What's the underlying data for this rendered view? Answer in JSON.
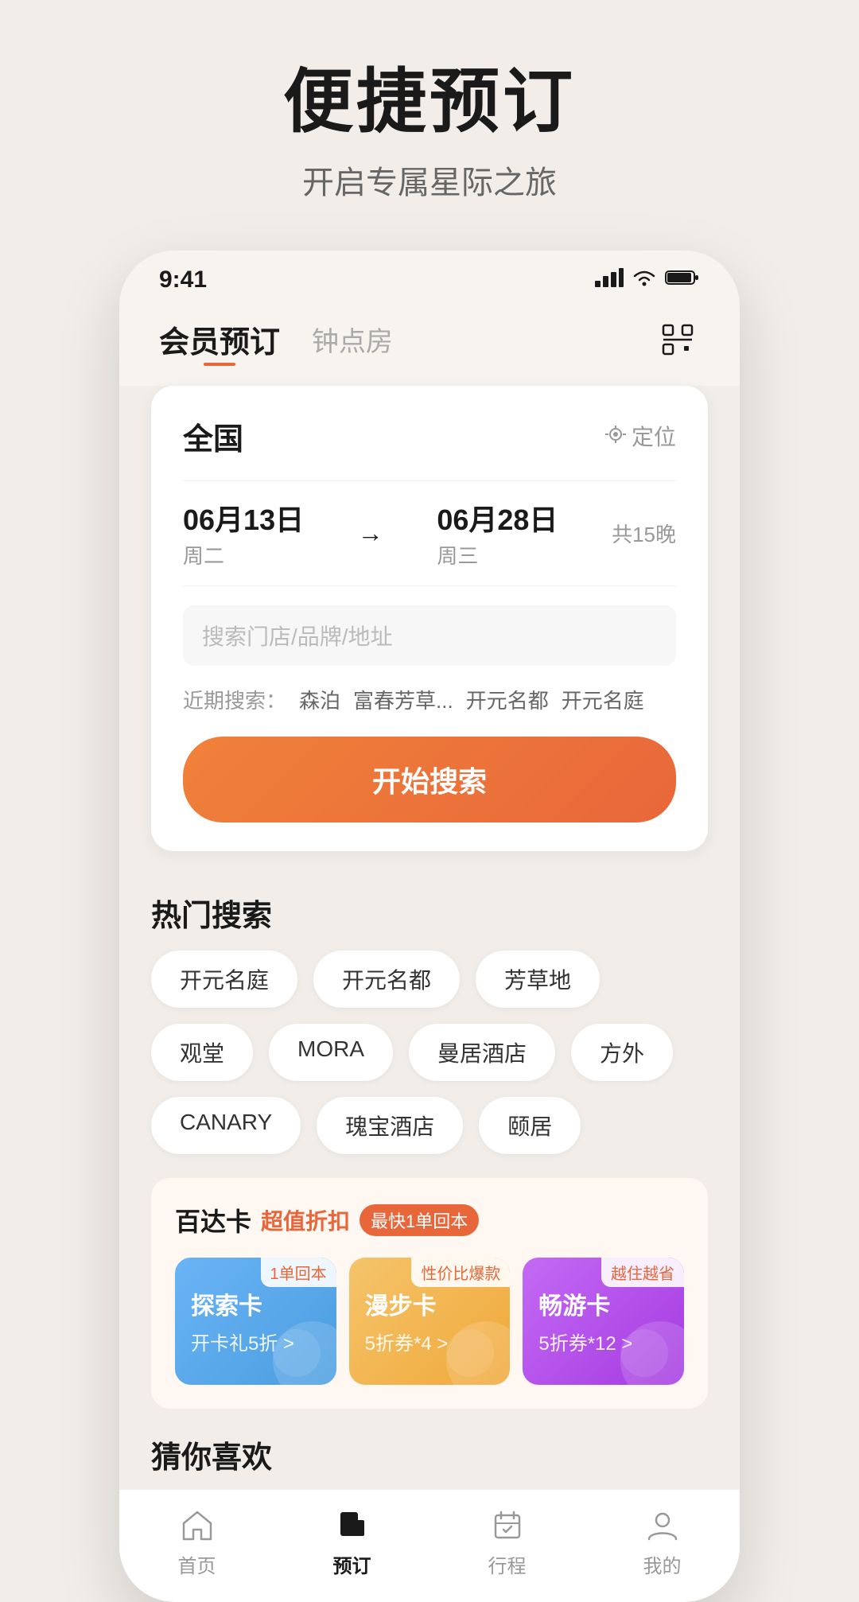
{
  "hero": {
    "title": "便捷预订",
    "subtitle": "开启专属星际之旅"
  },
  "status_bar": {
    "time": "9:41",
    "signal": "▐▐▐",
    "wifi": "wifi",
    "battery": "battery"
  },
  "nav": {
    "tab_active": "会员预订",
    "tab_inactive": "钟点房"
  },
  "search_card": {
    "location": "全国",
    "location_btn": "定位",
    "date_start": "06月13日",
    "date_start_week": "周二",
    "date_end": "06月28日",
    "date_end_week": "周三",
    "date_nights": "共15晚",
    "date_arrow": "→",
    "search_placeholder": "搜索门店/品牌/地址",
    "recent_label": "近期搜索：",
    "recent_items": [
      "森泊",
      "富春芳草...",
      "开元名都",
      "开元名庭"
    ],
    "search_btn": "开始搜索"
  },
  "hot_search": {
    "title": "热门搜索",
    "tags": [
      "开元名庭",
      "开元名都",
      "芳草地",
      "观堂",
      "MORA",
      "曼居酒店",
      "方外",
      "CANARY",
      "瑰宝酒店",
      "颐居"
    ]
  },
  "promo": {
    "title": "百达卡",
    "badge_text": "超值折扣",
    "fastest_text": "最快1单回本",
    "cards": [
      {
        "badge": "1单回本",
        "title": "探索卡",
        "sub": "开卡礼5折 >"
      },
      {
        "badge": "性价比爆款",
        "title": "漫步卡",
        "sub": "5折券*4 >"
      },
      {
        "badge": "越住越省",
        "title": "畅游卡",
        "sub": "5折券*12 >"
      }
    ]
  },
  "guess_section": {
    "title": "猜你喜欢"
  },
  "bottom_nav": {
    "items": [
      {
        "label": "首页",
        "active": false
      },
      {
        "label": "预订",
        "active": true
      },
      {
        "label": "行程",
        "active": false
      },
      {
        "label": "我的",
        "active": false
      }
    ]
  }
}
